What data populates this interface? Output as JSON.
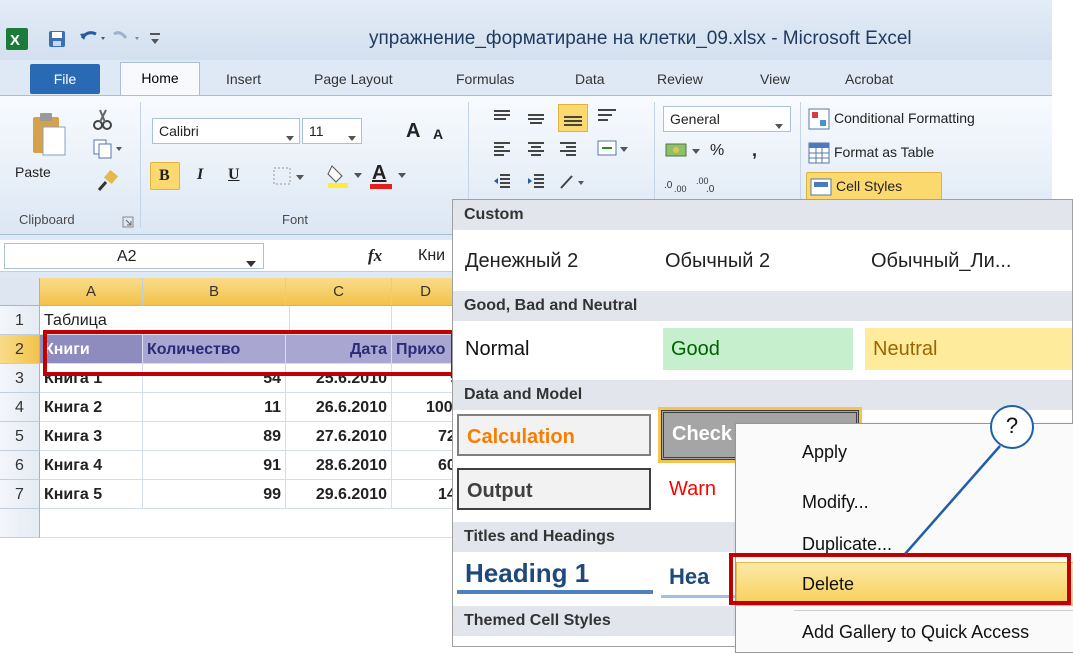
{
  "window": {
    "title": "упражнение_форматиране на клетки_09.xlsx - Microsoft Excel"
  },
  "tabs": [
    "File",
    "Home",
    "Insert",
    "Page Layout",
    "Formulas",
    "Data",
    "Review",
    "View",
    "Acrobat"
  ],
  "ribbon": {
    "clipboard": {
      "paste_label": "Paste",
      "group_label": "Clipboard"
    },
    "font": {
      "font_name": "Calibri",
      "font_size": "11",
      "group_label": "Font",
      "bold": "B",
      "italic": "I",
      "underline": "U",
      "text_color_letter": "A",
      "grow": "A",
      "shrink": "A"
    },
    "number": {
      "format": "General",
      "percent": "%",
      "comma": ","
    },
    "styles": {
      "conditional_formatting": "Conditional Formatting",
      "format_as_table": "Format as Table",
      "cell_styles": "Cell Styles"
    }
  },
  "formula_bar": {
    "name_box": "A2",
    "fx": "fx",
    "content": "Кни"
  },
  "grid": {
    "columns": [
      "A",
      "B",
      "C",
      "D"
    ],
    "rows": [
      {
        "num": "1",
        "a": "Таблица",
        "b": "",
        "c": "",
        "d": ""
      },
      {
        "num": "2",
        "a": "Книги",
        "b": "Количество",
        "c": "Дата",
        "d": "Прихо"
      },
      {
        "num": "3",
        "a": "Книга 1",
        "b": "54",
        "c": "25.6.2010",
        "d": "9"
      },
      {
        "num": "4",
        "a": "Книга 2",
        "b": "11",
        "c": "26.6.2010",
        "d": "100"
      },
      {
        "num": "5",
        "a": "Книга 3",
        "b": "89",
        "c": "27.6.2010",
        "d": "72"
      },
      {
        "num": "6",
        "a": "Книга 4",
        "b": "91",
        "c": "28.6.2010",
        "d": "60"
      },
      {
        "num": "7",
        "a": "Книга 5",
        "b": "99",
        "c": "29.6.2010",
        "d": "14"
      }
    ]
  },
  "gallery": {
    "sections": [
      {
        "header": "Custom",
        "items": [
          "Денежный 2",
          "Обычный 2",
          "Обычный_Ли..."
        ]
      },
      {
        "header": "Good, Bad and Neutral",
        "items": [
          "Normal",
          "Good",
          "Neutral"
        ]
      },
      {
        "header": "Data and Model",
        "items": [
          "Calculation",
          "Check Cell",
          "Output",
          "Warn"
        ]
      },
      {
        "header": "Titles and Headings",
        "items": [
          "Heading 1",
          "Hea"
        ]
      },
      {
        "header": "Themed Cell Styles",
        "items": []
      }
    ]
  },
  "context_menu": {
    "items": [
      "Apply",
      "Modify...",
      "Duplicate...",
      "Delete",
      "Add Gallery to Quick Access"
    ]
  },
  "callout": {
    "text": "?"
  },
  "colors": {
    "highlight_red": "#c00000",
    "file_blue": "#2a6ab5",
    "header_row_purple": "#8e8bbf",
    "menu_highlight": "#f9d86a"
  }
}
